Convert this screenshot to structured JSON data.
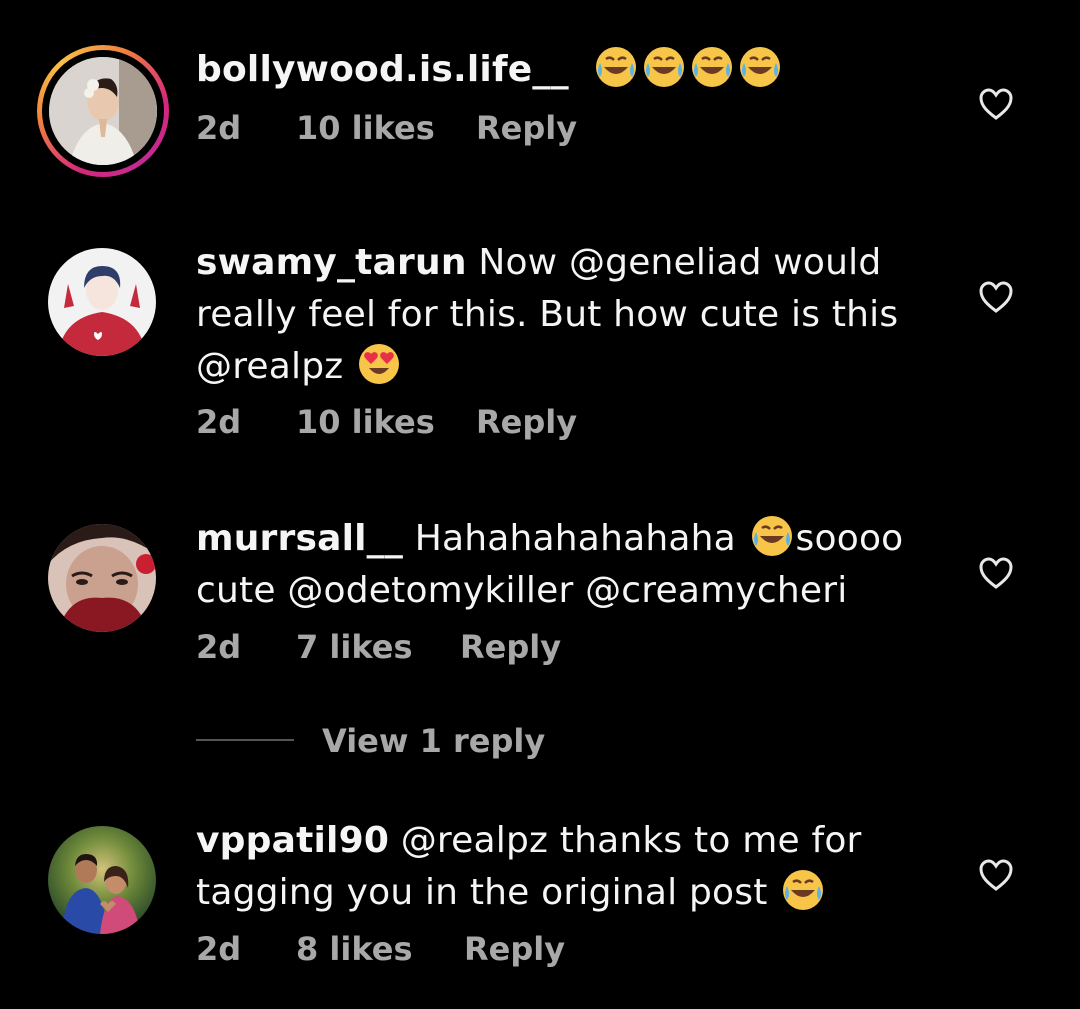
{
  "comments": [
    {
      "username": "bollywood.is.life__",
      "text": "",
      "emojis": [
        "😂",
        "😂",
        "😂",
        "😂"
      ],
      "time": "2d",
      "likes": "10 likes",
      "reply": "Reply",
      "has_story_ring": true
    },
    {
      "username": "swamy_tarun",
      "text": " Now @geneliad would really feel for this. But how cute is this @realpz ",
      "emojis": [
        "😍"
      ],
      "time": "2d",
      "likes": "10 likes",
      "reply": "Reply",
      "has_story_ring": false
    },
    {
      "username": "murrsall__",
      "text_before": " Hahahahahahaha ",
      "emojis": [
        "😂"
      ],
      "text_after": "soooo cute @odetomykiller  @creamycheri",
      "time": "2d",
      "likes": "7 likes",
      "reply": "Reply",
      "has_story_ring": false
    },
    {
      "username": "vppatil90",
      "text": " @realpz  thanks to me for tagging you in the original post ",
      "emojis": [
        "😂"
      ],
      "time": "2d",
      "likes": "8 likes",
      "reply": "Reply",
      "has_story_ring": false
    }
  ],
  "view_replies": "View 1 reply",
  "icons": {
    "like": "heart-outline-icon"
  },
  "colors": {
    "background": "#000000",
    "text": "#f5f5f5",
    "meta": "#a8a8a8"
  }
}
